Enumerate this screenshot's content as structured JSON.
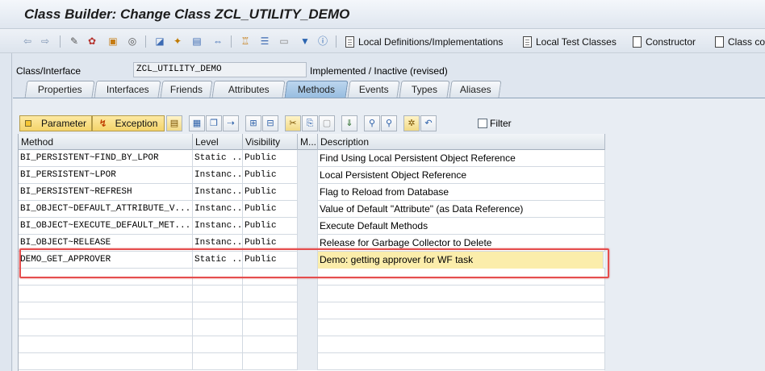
{
  "title": "Class Builder: Change Class ZCL_UTILITY_DEMO",
  "toolbar": {
    "local_defs_label": "Local Definitions/Implementations",
    "local_test_label": "Local Test Classes",
    "constructor_label": "Constructor",
    "class_con_label": "Class con"
  },
  "class": {
    "label": "Class/Interface",
    "value": "ZCL_UTILITY_DEMO",
    "status": "Implemented / Inactive (revised)"
  },
  "tabs": [
    "Properties",
    "Interfaces",
    "Friends",
    "Attributes",
    "Methods",
    "Events",
    "Types",
    "Aliases"
  ],
  "active_tab": "Methods",
  "grid_toolbar": {
    "parameter_label": "Parameter",
    "exception_label": "Exception",
    "filter_label": "Filter"
  },
  "table": {
    "headers": {
      "method": "Method",
      "level": "Level",
      "visibility": "Visibility",
      "m": "M...",
      "description": "Description"
    },
    "rows": [
      {
        "method": "BI_PERSISTENT~FIND_BY_LPOR",
        "level": "Static ...",
        "visibility": "Public",
        "description": "Find Using Local Persistent Object Reference"
      },
      {
        "method": "BI_PERSISTENT~LPOR",
        "level": "Instanc...",
        "visibility": "Public",
        "description": "Local Persistent Object Reference"
      },
      {
        "method": "BI_PERSISTENT~REFRESH",
        "level": "Instanc...",
        "visibility": "Public",
        "description": "Flag to Reload from Database"
      },
      {
        "method": "BI_OBJECT~DEFAULT_ATTRIBUTE_V...",
        "level": "Instanc...",
        "visibility": "Public",
        "description": "Value of Default \"Attribute\" (as Data Reference)"
      },
      {
        "method": "BI_OBJECT~EXECUTE_DEFAULT_MET...",
        "level": "Instanc...",
        "visibility": "Public",
        "description": "Execute Default Methods"
      },
      {
        "method": "BI_OBJECT~RELEASE",
        "level": "Instanc...",
        "visibility": "Public",
        "description": "Release for Garbage Collector to Delete"
      },
      {
        "method": "DEMO_GET_APPROVER",
        "level": "Static ...",
        "visibility": "Public",
        "description": "Demo: getting approver for WF task"
      }
    ]
  },
  "colors": {
    "active_tab": "#98bde0",
    "highlight_border": "#e54d4d",
    "edit_field": "#fbedab"
  }
}
